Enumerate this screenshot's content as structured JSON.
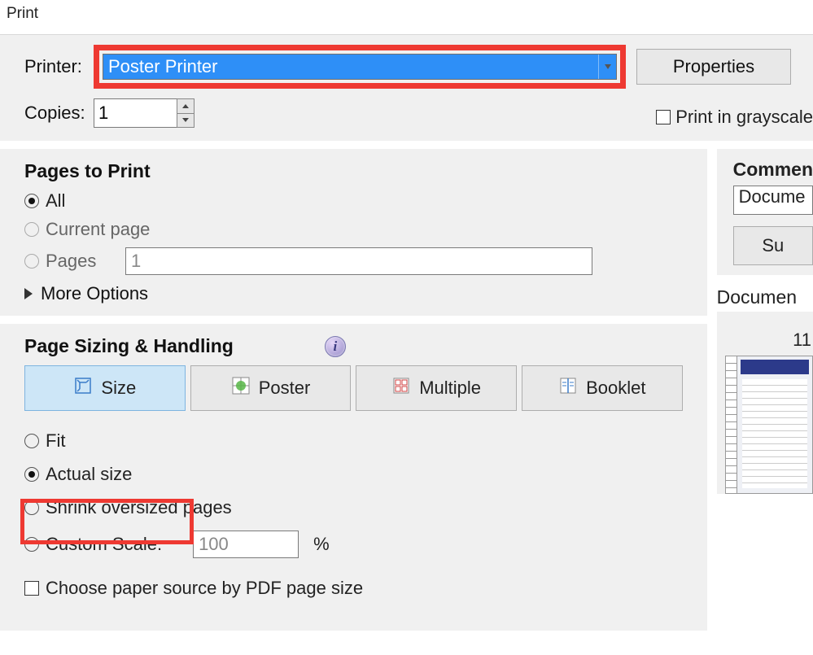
{
  "dialog": {
    "title": "Print"
  },
  "printer": {
    "label": "Printer:",
    "selected": "Poster Printer",
    "properties_label": "Properties"
  },
  "copies": {
    "label": "Copies:",
    "value": "1"
  },
  "grayscale": {
    "label": "Print in grayscale"
  },
  "pages_to_print": {
    "title": "Pages to Print",
    "all": "All",
    "current": "Current page",
    "pages": "Pages",
    "pages_value": "1",
    "more_options": "More Options"
  },
  "sizing": {
    "title": "Page Sizing & Handling",
    "tabs": {
      "size": "Size",
      "poster": "Poster",
      "multiple": "Multiple",
      "booklet": "Booklet"
    },
    "fit": "Fit",
    "actual": "Actual size",
    "shrink": "Shrink oversized pages",
    "custom": "Custom Scale:",
    "custom_value": "100",
    "custom_pct": "%",
    "choose_source": "Choose paper source by PDF page size"
  },
  "right": {
    "comments_title": "Commen",
    "comments_value": "Docume",
    "summarize_btn": "Su",
    "document_label": "Documen",
    "preview_dim": "11"
  }
}
